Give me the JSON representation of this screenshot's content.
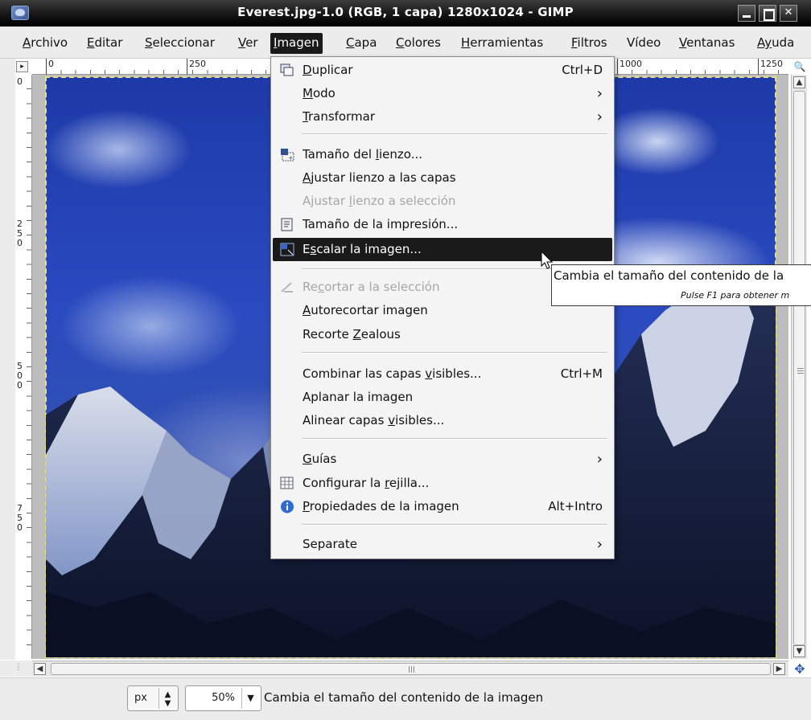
{
  "window": {
    "title": "Everest.jpg-1.0 (RGB, 1 capa) 1280x1024 - GIMP"
  },
  "menubar": {
    "items": [
      {
        "first": "A",
        "rest": "rchivo"
      },
      {
        "first": "E",
        "rest": "ditar"
      },
      {
        "first": "S",
        "rest": "eleccionar"
      },
      {
        "first": "V",
        "rest": "er"
      },
      {
        "first": "I",
        "rest": "magen"
      },
      {
        "first": "C",
        "rest": "apa"
      },
      {
        "first": "C",
        "rest": "olores"
      },
      {
        "first": "H",
        "rest": "erramientas"
      },
      {
        "first": "F",
        "rest": "iltros"
      },
      {
        "first": "V",
        "rest": "ídeo"
      },
      {
        "first": "V",
        "rest": "entanas"
      },
      {
        "first": "Ay",
        "rest": "uda"
      }
    ]
  },
  "rulers": {
    "horizontal": [
      "0",
      "250",
      "1000",
      "1250"
    ],
    "vertical": [
      "0",
      "250",
      "500",
      "750"
    ]
  },
  "image_menu": {
    "items": [
      {
        "pre": "",
        "key": "D",
        "post": "uplicar",
        "accel": "Ctrl+D",
        "icon": "duplicate-icon"
      },
      {
        "pre": "",
        "key": "M",
        "post": "odo",
        "submenu": "›"
      },
      {
        "pre": "",
        "key": "T",
        "post": "ransformar",
        "submenu": "›"
      },
      {
        "pre": "Tamaño del ",
        "key": "l",
        "post": "ienzo...",
        "icon": "canvas-size-icon"
      },
      {
        "pre": "",
        "key": "A",
        "post": "justar lienzo a las capas"
      },
      {
        "pre": "Ajustar ",
        "key": "l",
        "post": "ienzo a selección",
        "disabled": true
      },
      {
        "pre": "Tamaño de la impresión...",
        "key": "",
        "post": "",
        "icon": "print-size-icon"
      },
      {
        "pre": "E",
        "key": "s",
        "post": "calar la imagen...",
        "icon": "scale-icon",
        "highlighted": true
      },
      {
        "pre": "Re",
        "key": "c",
        "post": "ortar a la selección",
        "disabled": true,
        "icon": "crop-icon"
      },
      {
        "pre": "",
        "key": "A",
        "post": "utorecortar imagen"
      },
      {
        "pre": "Recorte ",
        "key": "Z",
        "post": "ealous"
      },
      {
        "pre": "Combinar las capas ",
        "key": "v",
        "post": "isibles...",
        "accel": "Ctrl+M"
      },
      {
        "pre": "Aplanar la imagen",
        "key": "",
        "post": ""
      },
      {
        "pre": "Alinear capas ",
        "key": "v",
        "post": "isibles..."
      },
      {
        "pre": "",
        "key": "G",
        "post": "uías",
        "submenu": "›"
      },
      {
        "pre": "Configurar la ",
        "key": "r",
        "post": "ejilla...",
        "icon": "grid-icon"
      },
      {
        "pre": "",
        "key": "P",
        "post": "ropiedades de la imagen",
        "accel": "Alt+Intro",
        "icon": "info-icon"
      },
      {
        "pre": "Separate",
        "key": "",
        "post": "",
        "submenu": "›"
      }
    ]
  },
  "tooltip": {
    "text": "Cambia el tamaño del contenido de la",
    "hint": "Pulse F1 para obtener m"
  },
  "statusbar": {
    "unit": "px",
    "zoom": "50%",
    "message": "Cambia el tamaño del contenido de la imagen"
  }
}
